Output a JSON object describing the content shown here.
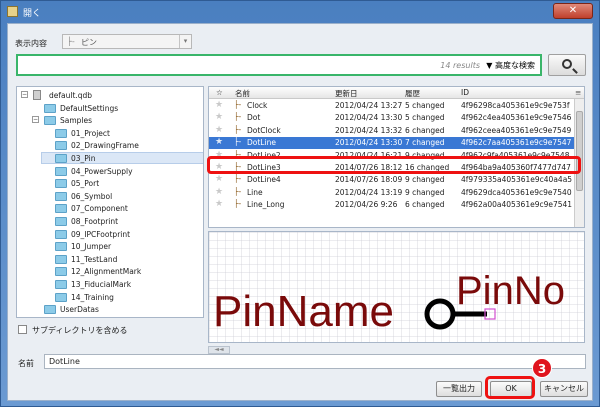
{
  "window": {
    "title": "開く",
    "close_glyph": "✕"
  },
  "view": {
    "label": "表示内容",
    "value": "ピン"
  },
  "search": {
    "results": "14 results",
    "advanced": "▼ 高度な検索"
  },
  "tree": {
    "items": [
      {
        "label": "default.qdb",
        "toggle": "−",
        "kind": "db"
      },
      {
        "label": "DefaultSettings",
        "kind": "folder"
      },
      {
        "label": "Samples",
        "toggle": "−",
        "kind": "folder"
      },
      {
        "label": "01_Project",
        "kind": "folder"
      },
      {
        "label": "02_DrawingFrame",
        "kind": "folder"
      },
      {
        "label": "03_Pin",
        "kind": "folder",
        "selected": true
      },
      {
        "label": "04_PowerSupply",
        "kind": "folder"
      },
      {
        "label": "05_Port",
        "kind": "folder"
      },
      {
        "label": "06_Symbol",
        "kind": "folder"
      },
      {
        "label": "07_Component",
        "kind": "folder"
      },
      {
        "label": "08_Footprint",
        "kind": "folder"
      },
      {
        "label": "09_IPCFootprint",
        "kind": "folder"
      },
      {
        "label": "10_Jumper",
        "kind": "folder"
      },
      {
        "label": "11_TestLand",
        "kind": "folder"
      },
      {
        "label": "12_AlignmentMark",
        "kind": "folder"
      },
      {
        "label": "13_FiducialMark",
        "kind": "folder"
      },
      {
        "label": "14_Training",
        "kind": "folder"
      },
      {
        "label": "UserDatas",
        "kind": "folder"
      }
    ]
  },
  "subdir": {
    "label": "サブディレクトリを含める"
  },
  "list": {
    "headers": {
      "star": "☆",
      "name": "名前",
      "updated": "更新日",
      "history": "履歴",
      "id": "ID"
    },
    "rows": [
      {
        "name": "Clock",
        "updated": "2012/04/24 13:27",
        "history": "5 changed",
        "id": "4f96298ca405361e9c9e753f"
      },
      {
        "name": "Dot",
        "updated": "2012/04/24 13:30",
        "history": "5 changed",
        "id": "4f962c4ea405361e9c9e7546"
      },
      {
        "name": "DotClock",
        "updated": "2012/04/24 13:32",
        "history": "6 changed",
        "id": "4f962ceea405361e9c9e7549"
      },
      {
        "name": "DotLine",
        "updated": "2012/04/24 13:30",
        "history": "7 changed",
        "id": "4f962c7aa405361e9c9e7547",
        "selected": true
      },
      {
        "name": "DotLine2",
        "updated": "2012/04/24 16:21",
        "history": "9 changed",
        "id": "4f962c9fa405361e9c9e7548"
      },
      {
        "name": "DotLine3",
        "updated": "2014/07/26 18:12",
        "history": "16 changed",
        "id": "4f964ba9a405360f7477d747"
      },
      {
        "name": "DotLine4",
        "updated": "2014/07/26 18:09",
        "history": "9 changed",
        "id": "4f979335a405361e9c40a4a5"
      },
      {
        "name": "Line",
        "updated": "2012/04/24 13:19",
        "history": "9 changed",
        "id": "4f9629dca405361e9c9e7540"
      },
      {
        "name": "Line_Long",
        "updated": "2012/04/26 9:26",
        "history": "6 changed",
        "id": "4f962a00a405361e9c9e7541"
      }
    ]
  },
  "preview": {
    "pin_name": "PinName",
    "pin_no": "PinNo"
  },
  "name_field": {
    "label": "名前",
    "value": "DotLine"
  },
  "buttons": {
    "list_output": "一覧出力",
    "ok": "OK",
    "cancel": "キャンセル"
  },
  "annotation": {
    "step": "3"
  },
  "colors": {
    "accent": "#3a78d4",
    "highlight": "#e11111",
    "preview_text": "#7a0a0a"
  }
}
